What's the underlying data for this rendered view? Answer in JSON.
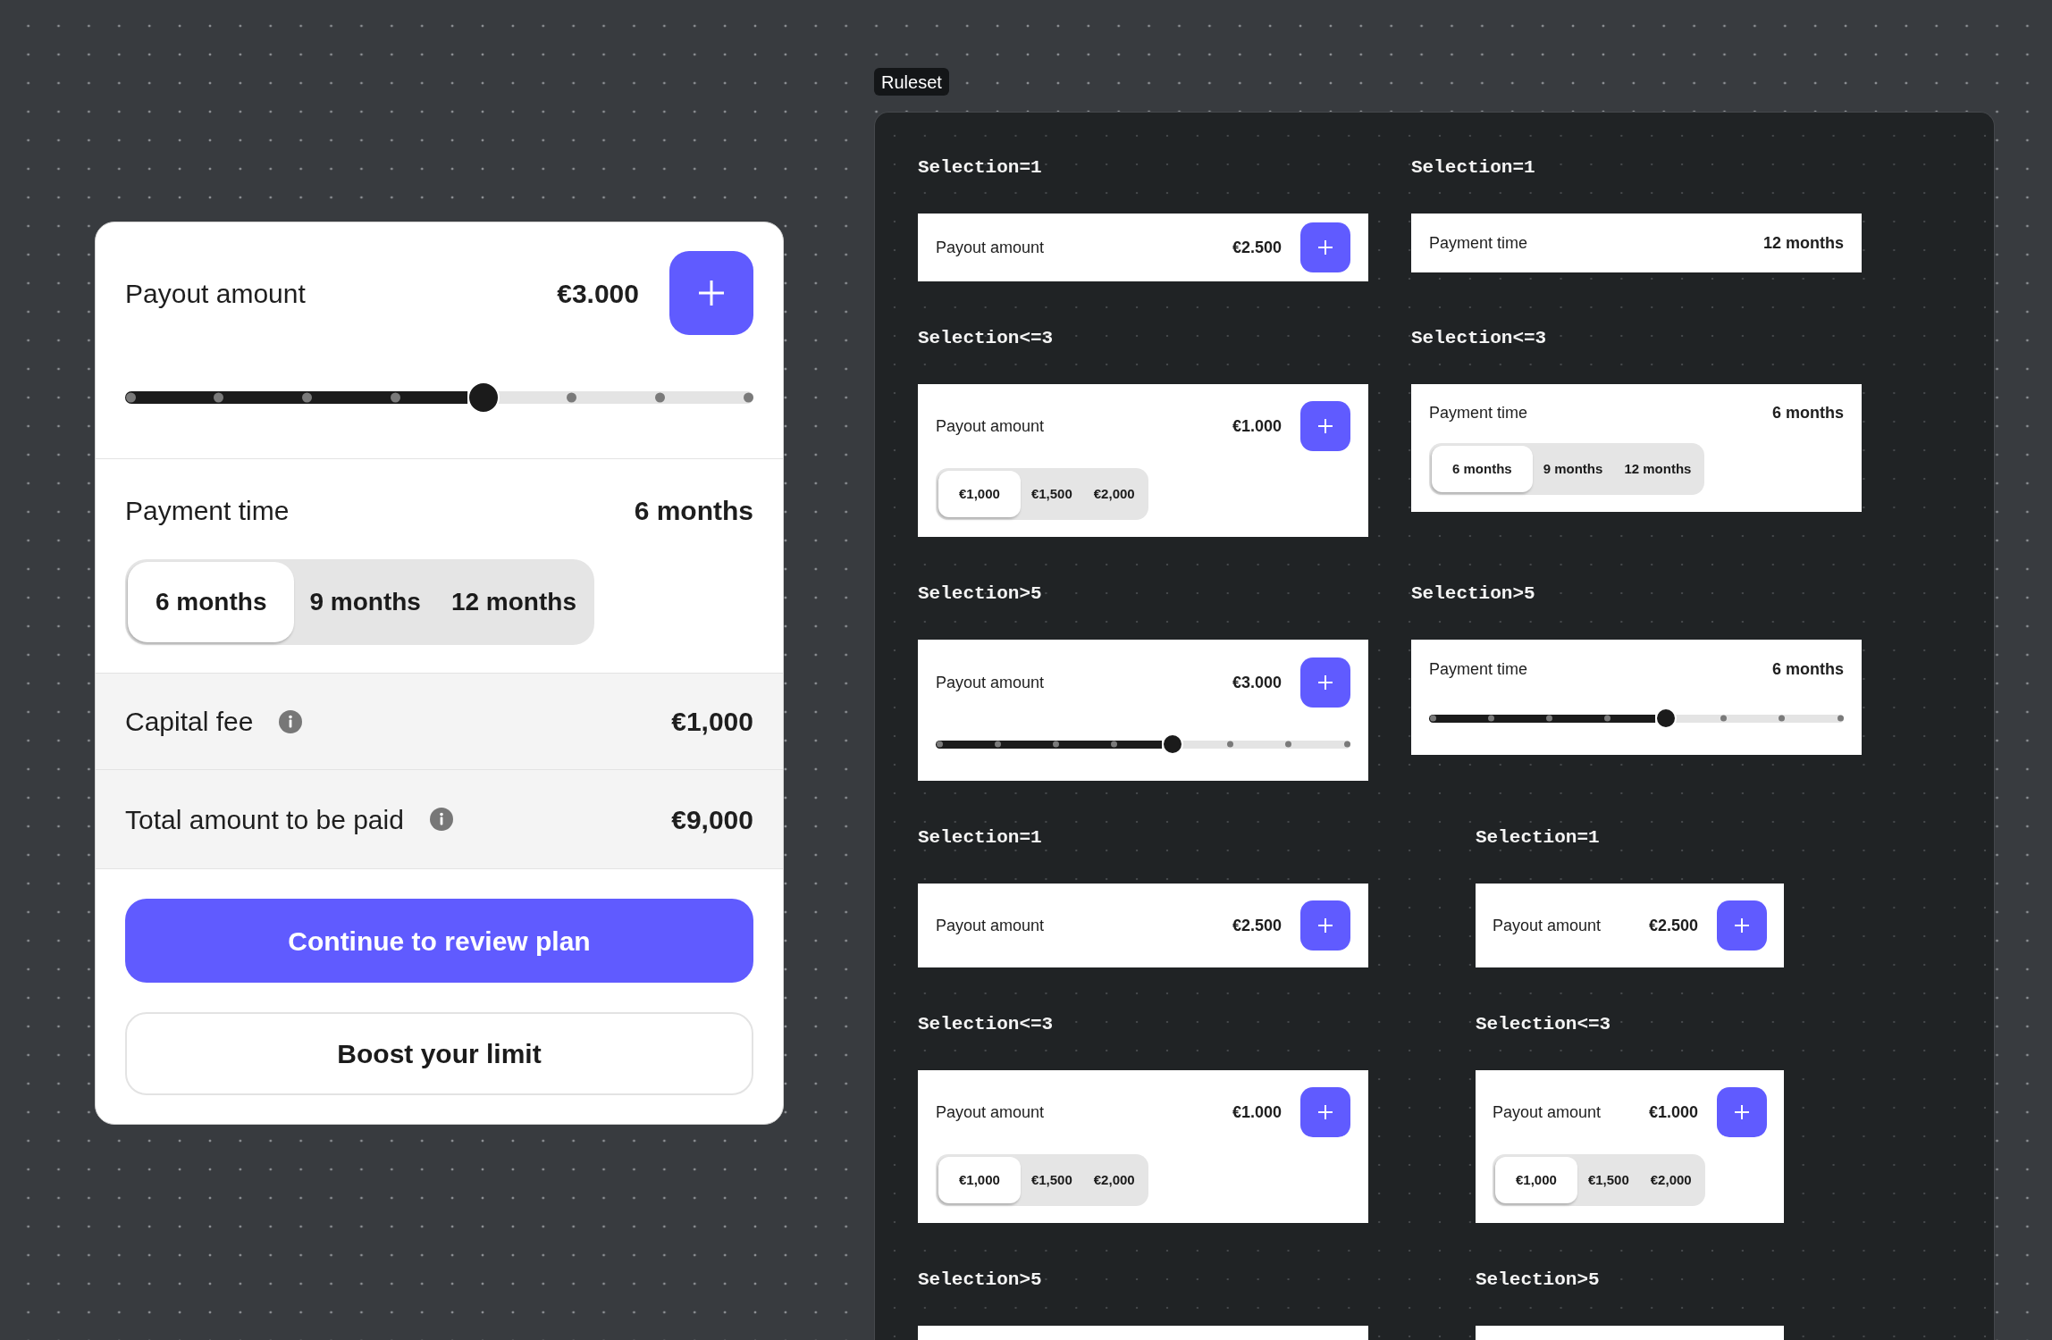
{
  "calculator": {
    "payout": {
      "label": "Payout amount",
      "value": "€3.000",
      "slider": {
        "level": 0.5714
      }
    },
    "payment_time": {
      "label": "Payment time",
      "value": "6 months",
      "options": [
        {
          "label": "6 months",
          "selected": true
        },
        {
          "label": "9 months",
          "selected": false
        },
        {
          "label": "12 months",
          "selected": false
        }
      ]
    },
    "summary": [
      {
        "label": "Capital fee",
        "value": "€1,000"
      },
      {
        "label": "Total amount to be paid",
        "value": "€9,000"
      }
    ],
    "buttons": [
      {
        "label": "Continue to review plan",
        "kind": "primary"
      },
      {
        "label": "Boost your limit",
        "kind": "secondary"
      }
    ]
  },
  "ruleset": {
    "label": "Ruleset",
    "groups": [
      {
        "columns": [
          {
            "compact": false,
            "sections": [
              {
                "heading": "Selection=1",
                "card": {
                  "kind": "value",
                  "label": "Payout amount",
                  "value": "€2.500",
                  "add_button": true
                }
              },
              {
                "heading": "Selection<=3",
                "card": {
                  "kind": "segmented",
                  "label": "Payout amount",
                  "value": "€1.000",
                  "add_button": true,
                  "options": [
                    {
                      "label": "€1,000",
                      "selected": true
                    },
                    {
                      "label": "€1,500",
                      "selected": false
                    },
                    {
                      "label": "€2,000",
                      "selected": false
                    }
                  ]
                }
              },
              {
                "heading": "Selection>5",
                "card": {
                  "kind": "slider",
                  "label": "Payout amount",
                  "value": "€3.000",
                  "add_button": true,
                  "level": 0.5714
                }
              }
            ]
          },
          {
            "compact": false,
            "sections": [
              {
                "heading": "Selection=1",
                "card": {
                  "kind": "value",
                  "label": "Payment time",
                  "value": "12 months",
                  "add_button": false
                }
              },
              {
                "heading": "Selection<=3",
                "card": {
                  "kind": "segmented",
                  "label": "Payment time",
                  "value": "6 months",
                  "add_button": false,
                  "options": [
                    {
                      "label": "6 months",
                      "selected": true
                    },
                    {
                      "label": "9 months",
                      "selected": false
                    },
                    {
                      "label": "12 months",
                      "selected": false
                    }
                  ]
                }
              },
              {
                "heading": "Selection>5",
                "card": {
                  "kind": "slider",
                  "label": "Payment time",
                  "value": "6 months",
                  "add_button": false,
                  "level": 0.5714
                }
              }
            ]
          }
        ]
      },
      {
        "columns": [
          {
            "compact": false,
            "sections": [
              {
                "heading": "Selection=1",
                "card": {
                  "kind": "value",
                  "label": "Payout amount",
                  "value": "€2.500",
                  "add_button": true
                }
              },
              {
                "heading": "Selection<=3",
                "card": {
                  "kind": "segmented",
                  "label": "Payout amount",
                  "value": "€1.000",
                  "add_button": true,
                  "options": [
                    {
                      "label": "€1,000",
                      "selected": true
                    },
                    {
                      "label": "€1,500",
                      "selected": false
                    },
                    {
                      "label": "€2,000",
                      "selected": false
                    }
                  ]
                }
              },
              {
                "heading": "Selection>5",
                "card": {
                  "kind": "partial"
                }
              }
            ]
          },
          {
            "compact": true,
            "sections": [
              {
                "heading": "Selection=1",
                "card": {
                  "kind": "value",
                  "label": "Payout amount",
                  "value": "€2.500",
                  "add_button": true
                }
              },
              {
                "heading": "Selection<=3",
                "card": {
                  "kind": "segmented",
                  "label": "Payout amount",
                  "value": "€1.000",
                  "add_button": true,
                  "options": [
                    {
                      "label": "€1,000",
                      "selected": true
                    },
                    {
                      "label": "€1,500",
                      "selected": false
                    },
                    {
                      "label": "€2,000",
                      "selected": false
                    }
                  ]
                }
              },
              {
                "heading": "Selection>5",
                "card": {
                  "kind": "partial"
                }
              }
            ]
          }
        ]
      }
    ]
  }
}
